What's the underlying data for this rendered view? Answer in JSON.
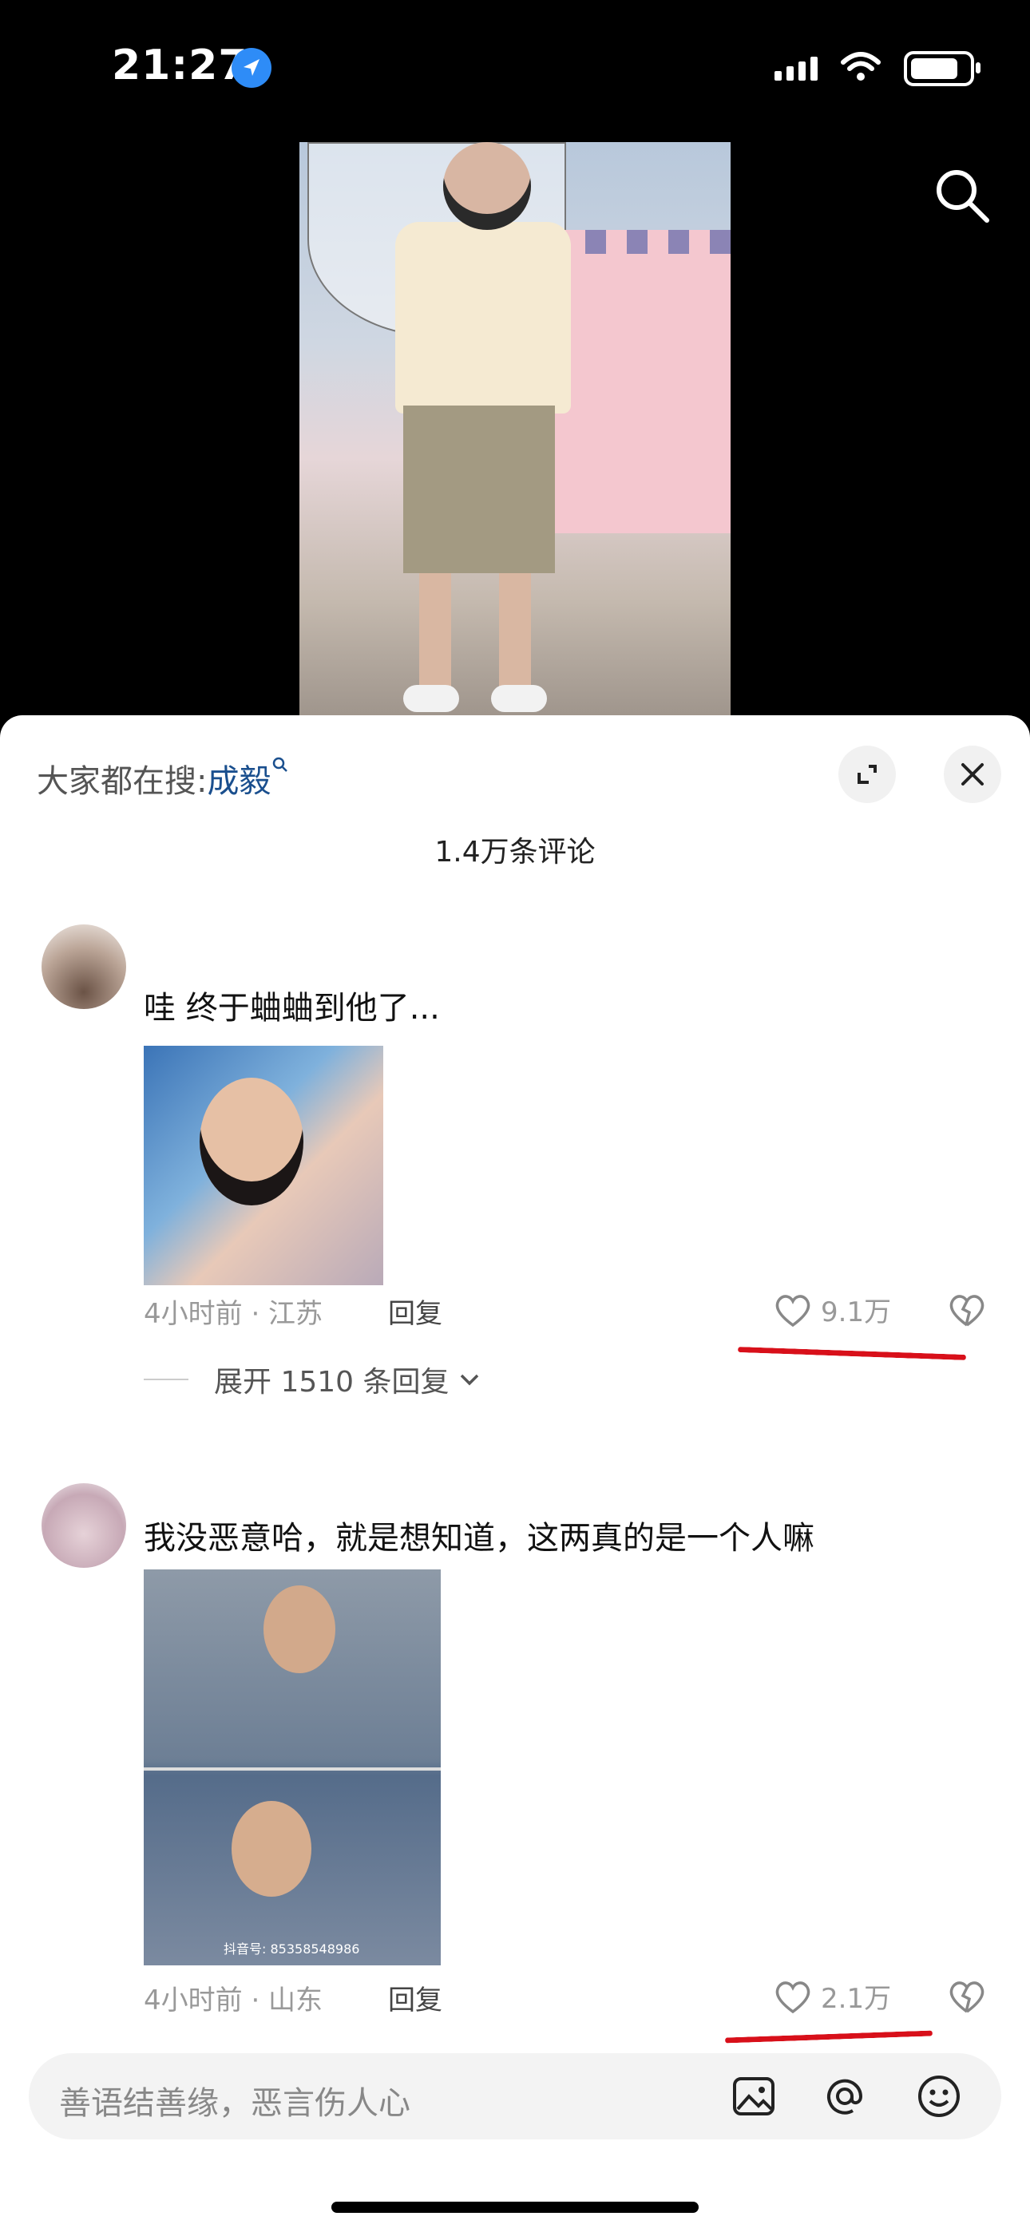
{
  "status_bar": {
    "time": "21:27"
  },
  "panel": {
    "trend_prefix": "大家都在搜:",
    "trend_keyword": "成毅",
    "comment_count": "1.4万条评论"
  },
  "comments": [
    {
      "text": "哇 终于蛐蛐到他了...",
      "meta": "4小时前 · 江苏",
      "reply": "回复",
      "likes": "9.1万",
      "expand": "展开 1510 条回复"
    },
    {
      "text": "我没恶意哈，就是想知道，这两真的是一个人嘛",
      "meta": "4小时前 · 山东",
      "reply": "回复",
      "likes": "2.1万",
      "image_watermark": "抖音号: 85358548986"
    }
  ],
  "input": {
    "placeholder": "善语结善缘，恶言伤人心"
  },
  "colors": {
    "accent_keyword": "#1a4f8e",
    "annotation_red": "#d8101a"
  }
}
